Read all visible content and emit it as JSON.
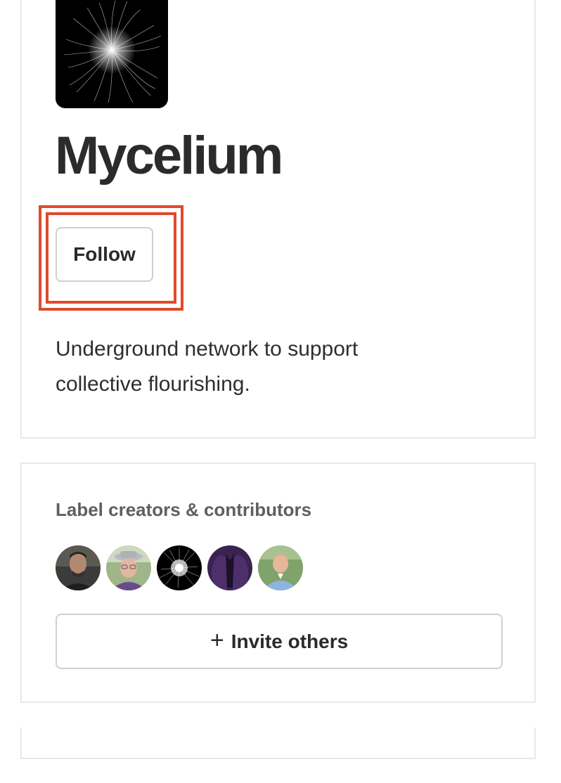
{
  "profile": {
    "title": "Mycelium",
    "follow_label": "Follow",
    "description": "Underground network to support collective flourishing."
  },
  "contributors": {
    "heading": "Label creators & contributors",
    "invite_label": "Invite others",
    "invite_icon": "+",
    "avatars": [
      {
        "name": "avatar-contributor-1"
      },
      {
        "name": "avatar-contributor-2"
      },
      {
        "name": "avatar-contributor-3"
      },
      {
        "name": "avatar-contributor-4"
      },
      {
        "name": "avatar-contributor-5"
      }
    ]
  },
  "colors": {
    "highlight": "#e04a2c",
    "border": "#e8e8e8",
    "text": "#2a2a2a",
    "muted": "#5f5f5f"
  }
}
